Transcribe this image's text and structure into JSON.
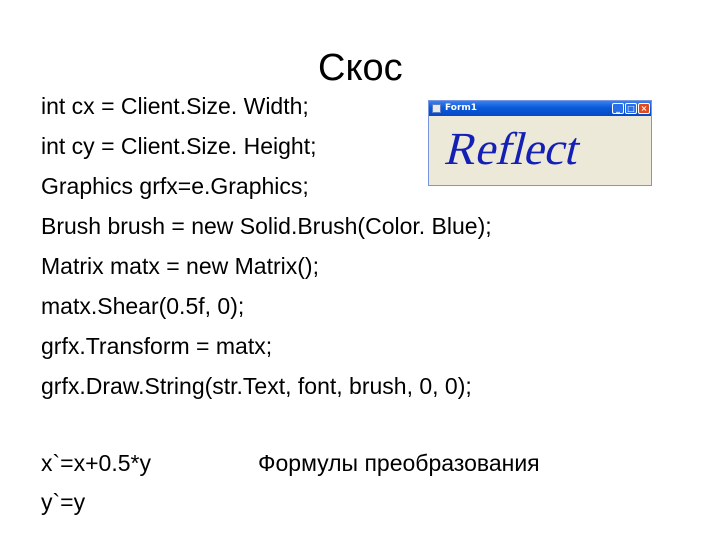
{
  "slide": {
    "title": "Скос",
    "code_lines": [
      "int cx = Client.Size. Width;",
      "int cy = Client.Size. Height;",
      "Graphics grfx=e.Graphics;",
      "Brush brush = new Solid.Brush(Color. Blue);",
      "Matrix matx = new Matrix();",
      "matx.Shear(0.5f, 0);",
      "grfx.Transform = matx;",
      "grfx.Draw.String(str.Text, font, brush, 0, 0);"
    ],
    "formulas": {
      "line1": "x`=x+0.5*y",
      "line2": "y`=y"
    },
    "formulas_caption": "Формулы преобразования"
  },
  "form_window": {
    "title": "Form1",
    "buttons": {
      "minimize_icon": "minimize-icon",
      "maximize_icon": "maximize-icon",
      "close_icon": "close-icon",
      "minimize_glyph": "_",
      "maximize_glyph": "□",
      "close_glyph": "×"
    },
    "content_text": "Reflect",
    "content_color": "#1420b4"
  }
}
